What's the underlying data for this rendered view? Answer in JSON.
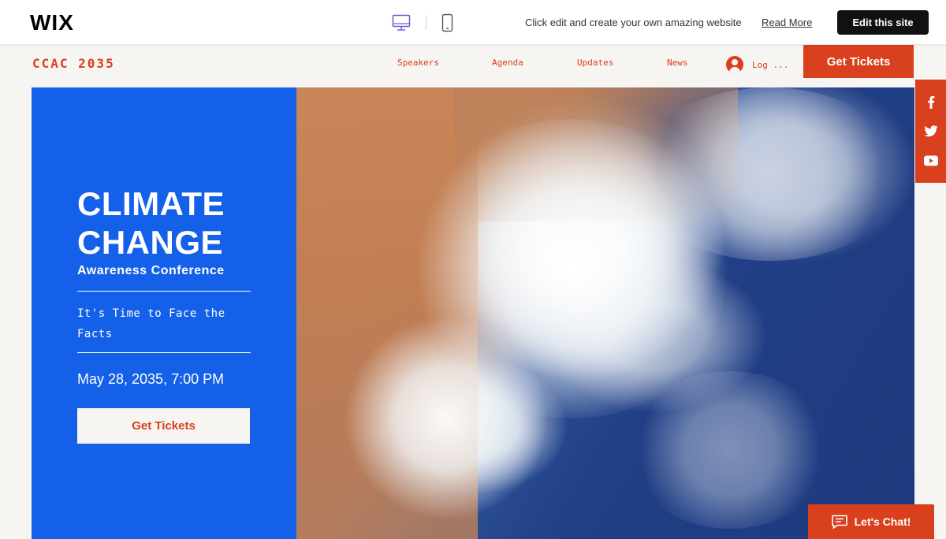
{
  "wixbar": {
    "logo": "WIX",
    "promo_text": "Click edit and create your own amazing website",
    "read_more": "Read More",
    "edit_button": "Edit this site",
    "device_icons": [
      "desktop-icon",
      "mobile-icon"
    ]
  },
  "header": {
    "logo": "CCAC 2035",
    "nav": [
      "Speakers",
      "Agenda",
      "Updates",
      "News"
    ],
    "login": "Log ...",
    "tickets_button": "Get Tickets"
  },
  "hero": {
    "title": "CLIMATE CHANGE",
    "subtitle": "Awareness Conference",
    "tagline": "It's Time to Face the Facts",
    "date": "May 28, 2035, 7:00 PM",
    "button": "Get Tickets"
  },
  "social": [
    "facebook-icon",
    "twitter-icon",
    "youtube-icon"
  ],
  "chat": {
    "label": "Let's Chat!"
  },
  "colors": {
    "accent": "#d9401e",
    "panel_blue": "#1560e8",
    "background": "#f7f5f2",
    "wix_button": "#111111"
  }
}
